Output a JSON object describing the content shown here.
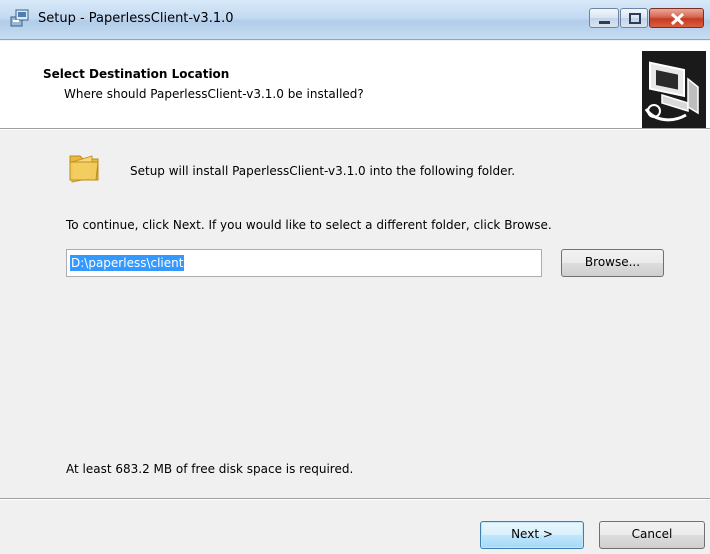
{
  "window": {
    "title": "Setup - PaperlessClient-v3.1.0",
    "icon": "setup-installer-icon"
  },
  "header": {
    "title": "Select Destination Location",
    "subtitle": "Where should PaperlessClient-v3.1.0 be installed?",
    "image": "installer-wizard-computer-icon"
  },
  "body": {
    "folder_icon": "folder-icon",
    "install_message": "Setup will install PaperlessClient-v3.1.0 into the following folder.",
    "continue_message": "To continue, click Next. If you would like to select a different folder, click Browse.",
    "path_value": "D:\\paperless\\client",
    "browse_label": "Browse...",
    "disk_space_message": "At least 683.2 MB of free disk space is required."
  },
  "footer": {
    "next_label": "Next >",
    "cancel_label": "Cancel"
  },
  "colors": {
    "selection": "#3399ff",
    "titlebar": "#c3daf2",
    "close_button": "#c53c23"
  }
}
